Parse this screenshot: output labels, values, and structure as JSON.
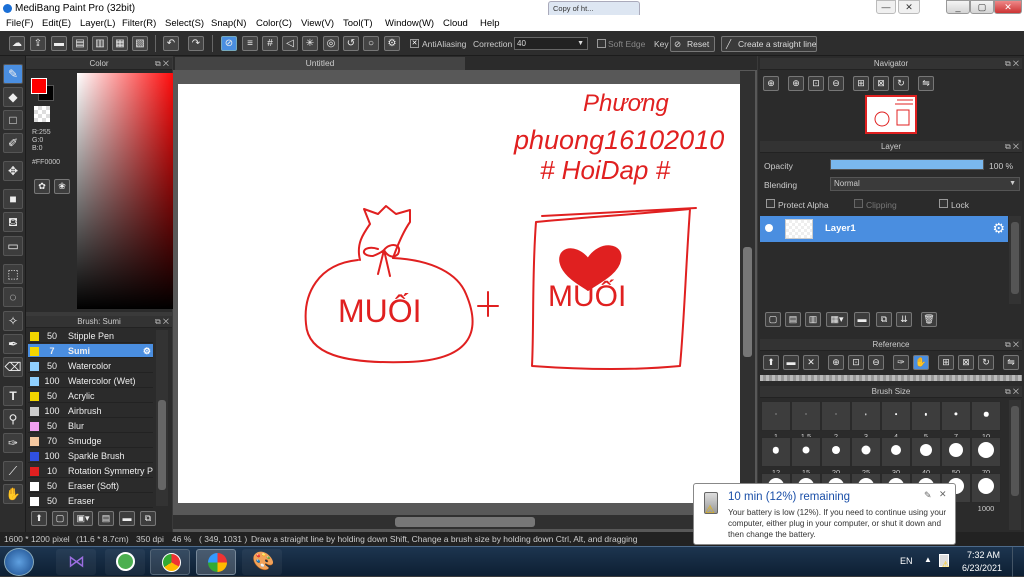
{
  "window": {
    "title": "MediBang Paint Pro (32bit)",
    "min_label": "_",
    "max_label": "▢",
    "close_label": "✕"
  },
  "chrome": {
    "partial_tab_label": "Copy of ht...",
    "chrome_btn_min": "—",
    "chrome_btn_close": "✕"
  },
  "menu": [
    "File(F)",
    "Edit(E)",
    "Layer(L)",
    "Filter(R)",
    "Select(S)",
    "Snap(N)",
    "Color(C)",
    "View(V)",
    "Tool(T)",
    "Window(W)",
    "Cloud",
    "Help"
  ],
  "toolbar": {
    "antialiasing_label": "AntiAliasing",
    "correction_label": "Correction",
    "correction_value": "40",
    "soft_edge_label": "Soft Edge",
    "key_label": "Key",
    "reset_label": "Reset",
    "straight_line_label": "Create a straight line"
  },
  "color_panel": {
    "title": "Color",
    "r": "R:255",
    "g": "G:0",
    "b": "B:0",
    "hex": "#FF0000",
    "primary_color": "#ff0000",
    "secondary_color": "#000000"
  },
  "brush_panel": {
    "title": "Brush: Sumi",
    "items": [
      {
        "size": "50",
        "name": "Stipple Pen",
        "color": "#f2d600"
      },
      {
        "size": "7",
        "name": "Sumi",
        "color": "#f2d600"
      },
      {
        "size": "50",
        "name": "Watercolor",
        "color": "#8fd0ff"
      },
      {
        "size": "100",
        "name": "Watercolor (Wet)",
        "color": "#8fd0ff"
      },
      {
        "size": "50",
        "name": "Acrylic",
        "color": "#f2d600"
      },
      {
        "size": "100",
        "name": "Airbrush",
        "color": "#cccccc"
      },
      {
        "size": "50",
        "name": "Blur",
        "color": "#f0a0f0"
      },
      {
        "size": "70",
        "name": "Smudge",
        "color": "#f5c8a0"
      },
      {
        "size": "100",
        "name": "Sparkle Brush",
        "color": "#3050e0"
      },
      {
        "size": "10",
        "name": "Rotation Symmetry P",
        "color": "#e02020"
      },
      {
        "size": "50",
        "name": "Eraser (Soft)",
        "color": "#ffffff"
      },
      {
        "size": "50",
        "name": "Eraser",
        "color": "#ffffff"
      }
    ]
  },
  "canvas": {
    "tab_label": "Untitled",
    "text_name": "Phương",
    "text_handle": "phuong16102010",
    "text_tag": "# HoiDap #",
    "text_bag": "MUỐI",
    "text_plus": "+",
    "text_pack": "MUỐI"
  },
  "navigator": {
    "title": "Navigator"
  },
  "layer_panel": {
    "title": "Layer",
    "opacity_label": "Opacity",
    "opacity_value": "100 %",
    "opacity_fraction": 1.0,
    "blending_label": "Blending",
    "blending_value": "Normal",
    "protect_alpha_label": "Protect Alpha",
    "clipping_label": "Clipping",
    "lock_label": "Lock",
    "layer_name": "Layer1"
  },
  "reference": {
    "title": "Reference"
  },
  "brush_size": {
    "title": "Brush Size",
    "row1": [
      "1",
      "1.5",
      "2",
      "3",
      "4",
      "5",
      "7",
      "10"
    ],
    "row2": [
      "12",
      "15",
      "20",
      "25",
      "30",
      "40",
      "50",
      "70"
    ],
    "row3_last": "1000"
  },
  "status": {
    "pixels": "1600 * 1200 pixel",
    "cm": "(11.6 * 8.7cm)",
    "dpi": "350 dpi",
    "zoom": "46 %",
    "coords": "( 349, 1031 )",
    "hint": "Draw a straight line by holding down Shift, Change a brush size by holding down Ctrl, Alt, and dragging"
  },
  "taskbar": {
    "lang": "EN",
    "time": "7:32 AM",
    "date": "6/23/2021"
  },
  "battery_balloon": {
    "title": "10 min (12%) remaining",
    "body": "Your battery is low (12%). If you need to continue using your computer, either plug in your computer, or shut it down and then change the battery."
  }
}
